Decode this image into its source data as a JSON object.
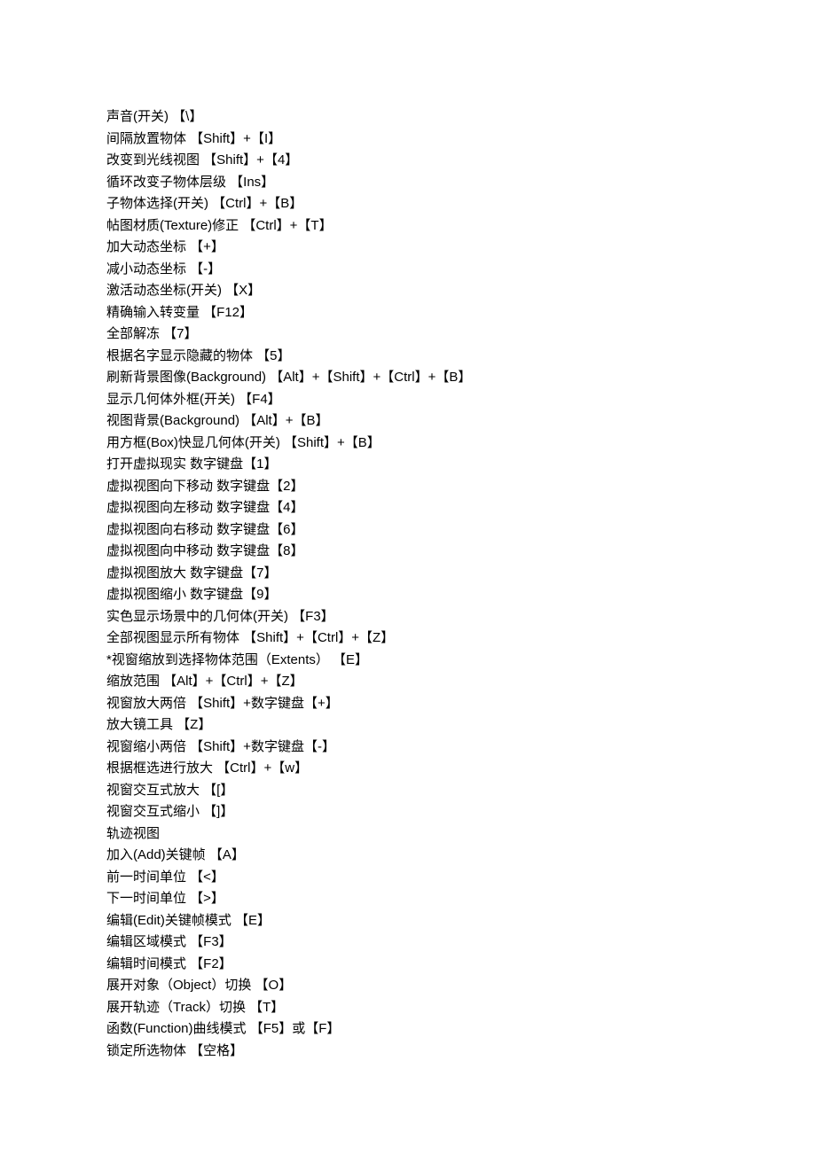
{
  "lines": [
    "声音(开关) 【\\】",
    "间隔放置物体 【Shift】+【I】",
    "改变到光线视图 【Shift】+【4】",
    "循环改变子物体层级 【Ins】",
    "子物体选择(开关) 【Ctrl】+【B】",
    "帖图材质(Texture)修正 【Ctrl】+【T】",
    "加大动态坐标 【+】",
    "减小动态坐标 【-】",
    "激活动态坐标(开关) 【X】",
    "精确输入转变量 【F12】",
    "全部解冻 【7】",
    "根据名字显示隐藏的物体 【5】",
    "刷新背景图像(Background) 【Alt】+【Shift】+【Ctrl】+【B】",
    "显示几何体外框(开关) 【F4】",
    "视图背景(Background) 【Alt】+【B】",
    "用方框(Box)快显几何体(开关) 【Shift】+【B】",
    "打开虚拟现实 数字键盘【1】",
    "虚拟视图向下移动 数字键盘【2】",
    "虚拟视图向左移动 数字键盘【4】",
    "虚拟视图向右移动 数字键盘【6】",
    "虚拟视图向中移动 数字键盘【8】",
    "虚拟视图放大 数字键盘【7】",
    "虚拟视图缩小 数字键盘【9】",
    "实色显示场景中的几何体(开关) 【F3】",
    "全部视图显示所有物体 【Shift】+【Ctrl】+【Z】",
    "*视窗缩放到选择物体范围（Extents） 【E】",
    "缩放范围 【Alt】+【Ctrl】+【Z】",
    "视窗放大两倍 【Shift】+数字键盘【+】",
    "放大镜工具 【Z】",
    "视窗缩小两倍 【Shift】+数字键盘【-】",
    "根据框选进行放大 【Ctrl】+【w】",
    "视窗交互式放大 【[】",
    "视窗交互式缩小 【]】",
    "轨迹视图",
    "加入(Add)关键帧 【A】",
    "前一时间单位 【<】",
    "下一时间单位 【>】",
    "编辑(Edit)关键帧模式 【E】",
    "编辑区域模式 【F3】",
    "编辑时间模式 【F2】",
    "展开对象（Object）切换 【O】",
    "展开轨迹（Track）切换 【T】",
    "函数(Function)曲线模式 【F5】或【F】",
    "锁定所选物体 【空格】"
  ]
}
